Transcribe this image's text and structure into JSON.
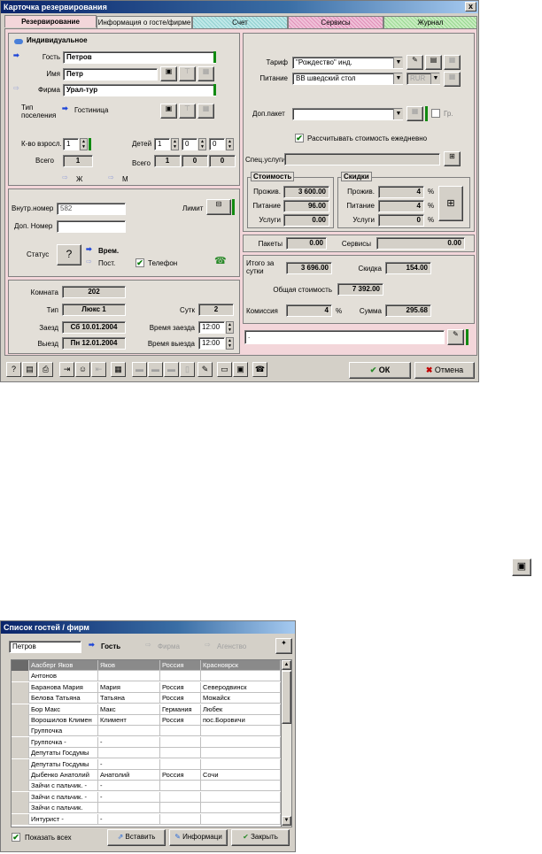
{
  "dialog1": {
    "title": "Карточка резервирования",
    "tabs": [
      "Резервирование",
      "Информация о госте/фирме",
      "Счет",
      "Сервисы",
      "Журнал"
    ],
    "left": {
      "individual": "Индивидуальное",
      "guest_label": "Гость",
      "guest_value": "Петров",
      "name_label": "Имя",
      "name_value": "Петр",
      "firm_label": "Фирма",
      "firm_value": "Урал-тур",
      "placement_type_label": "Тип поселения",
      "placement_type_value": "Гостиница",
      "adults_label": "К-во взросл.",
      "adults_value": "1",
      "children_label": "Детей",
      "children_values": [
        "1",
        "0",
        "0"
      ],
      "total_label": "Всего",
      "total_adults": "1",
      "total2_label": "Всего",
      "total_children": [
        "1",
        "0",
        "0"
      ],
      "female": "Ж",
      "male": "М",
      "internal_no_label": "Внутр.номер",
      "internal_no_value": "582",
      "extra_no_label": "Доп. Номер",
      "extra_no_value": "",
      "limit_label": "Лимит",
      "status_label": "Статус",
      "status_temp": "Врем.",
      "status_perm": "Пост.",
      "phone": "Телефон",
      "room_label": "Комната",
      "room_value": "202",
      "type_label": "Тип",
      "type_value": "Люкс 1",
      "nights_label": "Сутк",
      "nights_value": "2",
      "arrival_label": "Заезд",
      "arrival_value": "Сб 10.01.2004",
      "arrival_time_label": "Время заезда",
      "arrival_time_value": "12:00",
      "departure_label": "Выезд",
      "departure_value": "Пн 12.01.2004",
      "departure_time_label": "Время выезда",
      "departure_time_value": "12:00"
    },
    "right": {
      "tariff_label": "Тариф",
      "tariff_value": "\"Рождество\" инд.",
      "meal_label": "Питание",
      "meal_value": "BB шведский стол",
      "currency": "RUR",
      "extra_package_label": "Доп.пакет",
      "extra_package_value": "",
      "group_label": "Гр.",
      "daily_calc_label": "Рассчитывать стоимость ежедневно",
      "spec_services_label": "Спец.услуги",
      "cost_title": "Стоимость",
      "cost_accommodation_label": "Прожив.",
      "cost_accommodation_value": "3 600.00",
      "cost_meal_label": "Питание",
      "cost_meal_value": "96.00",
      "cost_services_label": "Услуги",
      "cost_services_value": "0.00",
      "discount_title": "Скидки",
      "disc_accommodation_label": "Прожив.",
      "disc_accommodation_value": "4",
      "disc_meal_label": "Питание",
      "disc_meal_value": "4",
      "disc_services_label": "Услуги",
      "disc_services_value": "0",
      "percent": "%",
      "packages_label": "Пакеты",
      "packages_value": "0.00",
      "services_label": "Сервисы",
      "services_value": "0.00",
      "daily_total_label": "Итого за сутки",
      "daily_total_value": "3 696.00",
      "discount_label": "Скидка",
      "discount_value": "154.00",
      "total_cost_label": "Общая стоимость",
      "total_cost_value": "7 392.00",
      "commission_label": "Комиссия",
      "commission_value": "4",
      "sum_label": "Сумма",
      "sum_value": "295.68",
      "comment_value": "."
    },
    "ok_label": "ОК",
    "cancel_label": "Отмена"
  },
  "dialog2": {
    "title": "Список гостей / фирм",
    "search_value": "Петров",
    "mode_guest": "Гость",
    "mode_firm": "Фирма",
    "mode_agency": "Агенство",
    "rows": [
      [
        "Аасберг Яков",
        "Яков",
        "Россия",
        "Красноярск"
      ],
      [
        "Антонов",
        "",
        "",
        ""
      ],
      [
        "Баранова Мария",
        "Мария",
        "Россия",
        "Северодвинск"
      ],
      [
        "Белова Татьяна",
        "Татьяна",
        "Россия",
        "Можайск"
      ],
      [
        "Бор Макс",
        "Макс",
        "Германия",
        "Любек"
      ],
      [
        "Ворошилов Климен",
        "Климент",
        "Россия",
        "пос.Боровичи"
      ],
      [
        "Группочка",
        "",
        "",
        ""
      ],
      [
        "Группочка -",
        "-",
        "",
        ""
      ],
      [
        "Депутаты Госдумы",
        "",
        "",
        ""
      ],
      [
        "Депутаты Госдумы",
        "-",
        "",
        ""
      ],
      [
        "Дыбенко Анатолий",
        "Анатолий",
        "Россия",
        "Сочи"
      ],
      [
        "Зайчи с пальчик. -",
        "-",
        "",
        ""
      ],
      [
        "Зайчи с пальчик. -",
        "-",
        "",
        ""
      ],
      [
        "Зайчи с пальчик.",
        "",
        "",
        ""
      ],
      [
        "Интурист -",
        "-",
        "",
        ""
      ]
    ],
    "show_all_label": "Показать всех",
    "insert_label": "Вставить",
    "info_label": "Информаци",
    "close_label": "Закрыть"
  }
}
